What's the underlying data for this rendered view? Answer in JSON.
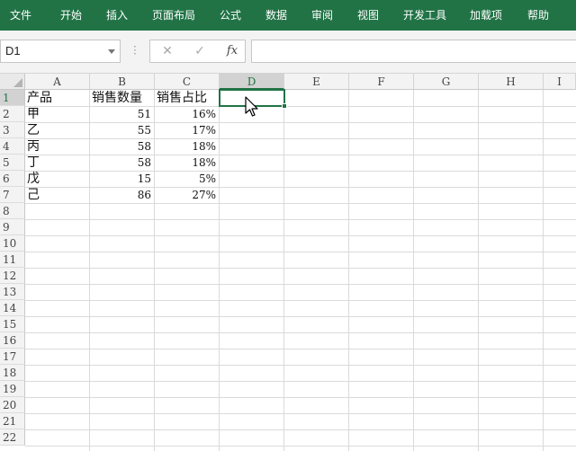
{
  "ribbon": {
    "color": "#217346",
    "tabs": [
      "文件",
      "开始",
      "插入",
      "页面布局",
      "公式",
      "数据",
      "审阅",
      "视图",
      "开发工具",
      "加载项",
      "帮助"
    ]
  },
  "formula_bar": {
    "name_box": "D1",
    "cancel_icon": "close-icon",
    "confirm_icon": "check-icon",
    "function_label": "fx",
    "formula": ""
  },
  "sheet": {
    "columns": [
      "A",
      "B",
      "C",
      "D",
      "E",
      "F",
      "G",
      "H",
      "I"
    ],
    "selected_column": "D",
    "selected_row": "1",
    "rows": [
      "1",
      "2",
      "3",
      "4",
      "5",
      "6",
      "7",
      "8",
      "9",
      "10",
      "11",
      "12",
      "13",
      "14",
      "15",
      "16",
      "17",
      "18",
      "19",
      "20",
      "21",
      "22"
    ],
    "headers": {
      "a": "产品",
      "b": "销售数量",
      "c": "销售占比"
    },
    "data": [
      {
        "a": "甲",
        "b": "51",
        "c": "16%"
      },
      {
        "a": "乙",
        "b": "55",
        "c": "17%"
      },
      {
        "a": "丙",
        "b": "58",
        "c": "18%"
      },
      {
        "a": "丁",
        "b": "58",
        "c": "18%"
      },
      {
        "a": "戊",
        "b": "15",
        "c": "5%"
      },
      {
        "a": "己",
        "b": "86",
        "c": "27%"
      }
    ]
  }
}
